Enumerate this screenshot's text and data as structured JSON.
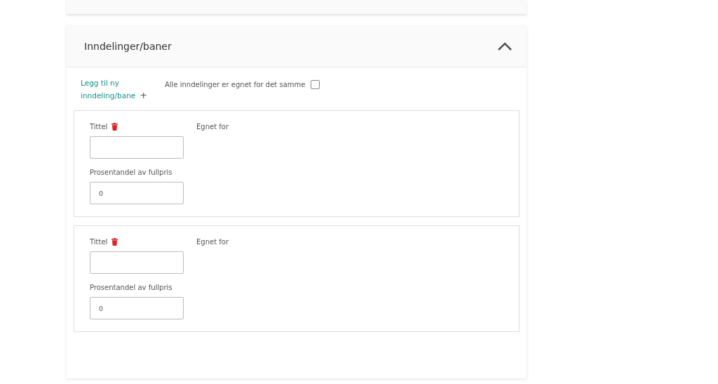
{
  "section": {
    "title": "Inndelinger/baner",
    "expanded": true,
    "add_link": "Legg til ny inndeling/bane",
    "add_icon": "+",
    "same_for_all": {
      "label": "Alle inndelinger er egnet for det samme",
      "checked": false
    },
    "divisions": [
      {
        "title_label": "Tittel",
        "suitable_label": "Egnet for",
        "percent_label": "Prosentandel av fullpris",
        "percent_value": "0"
      },
      {
        "title_label": "Tittel",
        "suitable_label": "Egnet for",
        "percent_label": "Prosentandel av fullpris",
        "percent_value": "0"
      }
    ]
  }
}
